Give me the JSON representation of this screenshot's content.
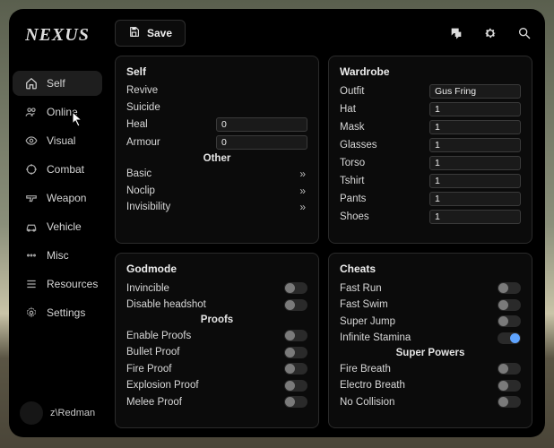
{
  "logo": "NEXUS",
  "topbar": {
    "save_label": "Save"
  },
  "sidebar": {
    "items": [
      {
        "label": "Self"
      },
      {
        "label": "Online"
      },
      {
        "label": "Visual"
      },
      {
        "label": "Combat"
      },
      {
        "label": "Weapon"
      },
      {
        "label": "Vehicle"
      },
      {
        "label": "Misc"
      },
      {
        "label": "Resources"
      },
      {
        "label": "Settings"
      }
    ],
    "user": "z\\Redman"
  },
  "panels": {
    "self": {
      "title": "Self",
      "revive": "Revive",
      "suicide": "Suicide",
      "heal": "Heal",
      "heal_value": "0",
      "armour": "Armour",
      "armour_value": "0",
      "other": "Other",
      "basic": "Basic",
      "noclip": "Noclip",
      "invisibility": "Invisibility"
    },
    "wardrobe": {
      "title": "Wardrobe",
      "outfit": "Outfit",
      "outfit_value": "Gus Fring",
      "hat": "Hat",
      "hat_value": "1",
      "mask": "Mask",
      "mask_value": "1",
      "glasses": "Glasses",
      "glasses_value": "1",
      "torso": "Torso",
      "torso_value": "1",
      "tshirt": "Tshirt",
      "tshirt_value": "1",
      "pants": "Pants",
      "pants_value": "1",
      "shoes": "Shoes",
      "shoes_value": "1"
    },
    "godmode": {
      "title": "Godmode",
      "invincible": "Invincible",
      "disable_headshot": "Disable headshot",
      "proofs": "Proofs",
      "enable_proofs": "Enable Proofs",
      "bullet_proof": "Bullet Proof",
      "fire_proof": "Fire Proof",
      "explosion_proof": "Explosion Proof",
      "melee_proof": "Melee Proof"
    },
    "cheats": {
      "title": "Cheats",
      "fast_run": "Fast Run",
      "fast_swim": "Fast Swim",
      "super_jump": "Super Jump",
      "infinite_stamina": "Infinite Stamina",
      "super_powers": "Super Powers",
      "fire_breath": "Fire Breath",
      "electro_breath": "Electro Breath",
      "no_collision": "No Collision"
    }
  }
}
